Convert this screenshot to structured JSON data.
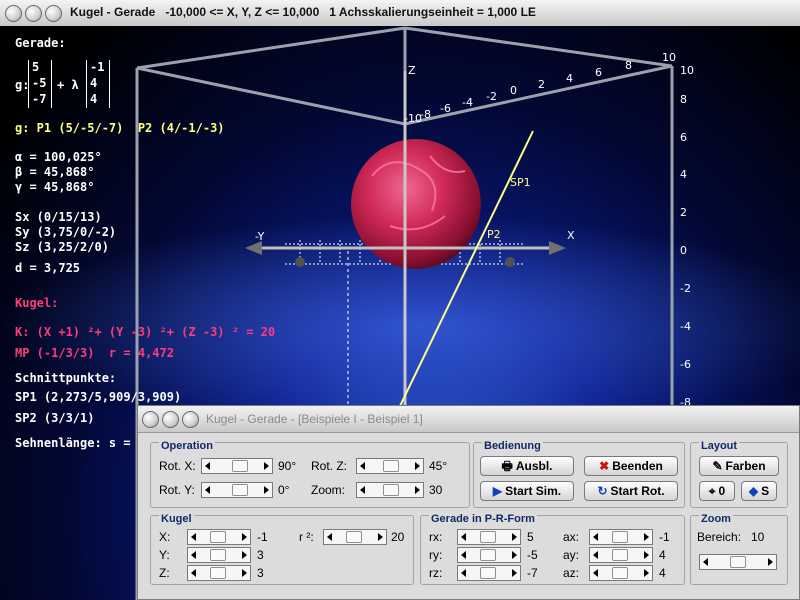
{
  "main_window": {
    "title": "Kugel - Gerade   -10,000 <= X, Y, Z <= 10,000   1 Achsskalierungseinheit = 1,000 LE"
  },
  "info_panel": {
    "gerade_heading": "Gerade:",
    "g_label": "g:",
    "vector1": [
      "5",
      "-5",
      "-7"
    ],
    "plus_lambda": "+ λ",
    "vector2": [
      "-1",
      "4",
      "4"
    ],
    "points_line": "g: P1 (5/-5/-7)  P2 (4/-1/-3)",
    "alpha": "α = 100,025°",
    "beta": "β = 45,868°",
    "gamma": "γ = 45,868°",
    "sx": "Sx (0/15/13)",
    "sy": "Sy (3,75/0/-2)",
    "sz": "Sz (3,25/2/0)",
    "d": "d = 3,725",
    "kugel_heading": "Kugel:",
    "kugel_eq": "K: (X +1) ²+ (Y -3) ²+ (Z -3) ² = 20",
    "mp": "MP (-1/3/3)  r = 4,472",
    "schnitt_heading": "Schnittpunkte:",
    "sp1": "SP1 (2,273/5,909/3,909)",
    "sp2": "SP2 (3/3/1)",
    "sehnen": "Sehnenlänge: s ="
  },
  "scene": {
    "axis_z": "Z",
    "axis_x": "X",
    "axis_y": "-Y",
    "sp1_label": "SP1",
    "sp2_label": "P2",
    "right_ticks": [
      "10",
      "8",
      "6",
      "4",
      "2",
      "0",
      "-2",
      "-4",
      "-6",
      "-8"
    ],
    "top_ticks": [
      "-10",
      "-8",
      "-6",
      "-4",
      "-2",
      "0",
      "2",
      "4",
      "6",
      "8",
      "10"
    ],
    "colors": {
      "sphere": "#d8305a",
      "line": "#ffff88",
      "cube": "#9aa3ad"
    }
  },
  "dialog": {
    "title": "Kugel - Gerade - [Beispiele I - Beispiel 1]",
    "operation": {
      "title": "Operation",
      "rot_x_label": "Rot. X:",
      "rot_x_value": "90°",
      "rot_y_label": "Rot. Y:",
      "rot_y_value": "0°",
      "rot_z_label": "Rot. Z:",
      "rot_z_value": "45°",
      "zoom_label": "Zoom:",
      "zoom_value": "30"
    },
    "bedienung": {
      "title": "Bedienung",
      "ausbl": "Ausbl.",
      "beenden": "Beenden",
      "start_sim": "Start Sim.",
      "start_rot": "Start Rot."
    },
    "layout": {
      "title": "Layout",
      "farben": "Farben",
      "btn_0": "0",
      "btn_s": "S"
    },
    "kugel": {
      "title": "Kugel",
      "x_label": "X:",
      "x_value": "-1",
      "y_label": "Y:",
      "y_value": "3",
      "z_label": "Z:",
      "z_value": "3",
      "r2_label": "r ²:",
      "r2_value": "20"
    },
    "gerade": {
      "title": "Gerade in P-R-Form",
      "rx_label": "rx:",
      "rx_value": "5",
      "ry_label": "ry:",
      "ry_value": "-5",
      "rz_label": "rz:",
      "rz_value": "-7",
      "ax_label": "ax:",
      "ax_value": "-1",
      "ay_label": "ay:",
      "ay_value": "4",
      "az_label": "az:",
      "az_value": "4"
    },
    "zoom": {
      "title": "Zoom",
      "bereich_label": "Bereich:",
      "bereich_value": "10"
    }
  }
}
